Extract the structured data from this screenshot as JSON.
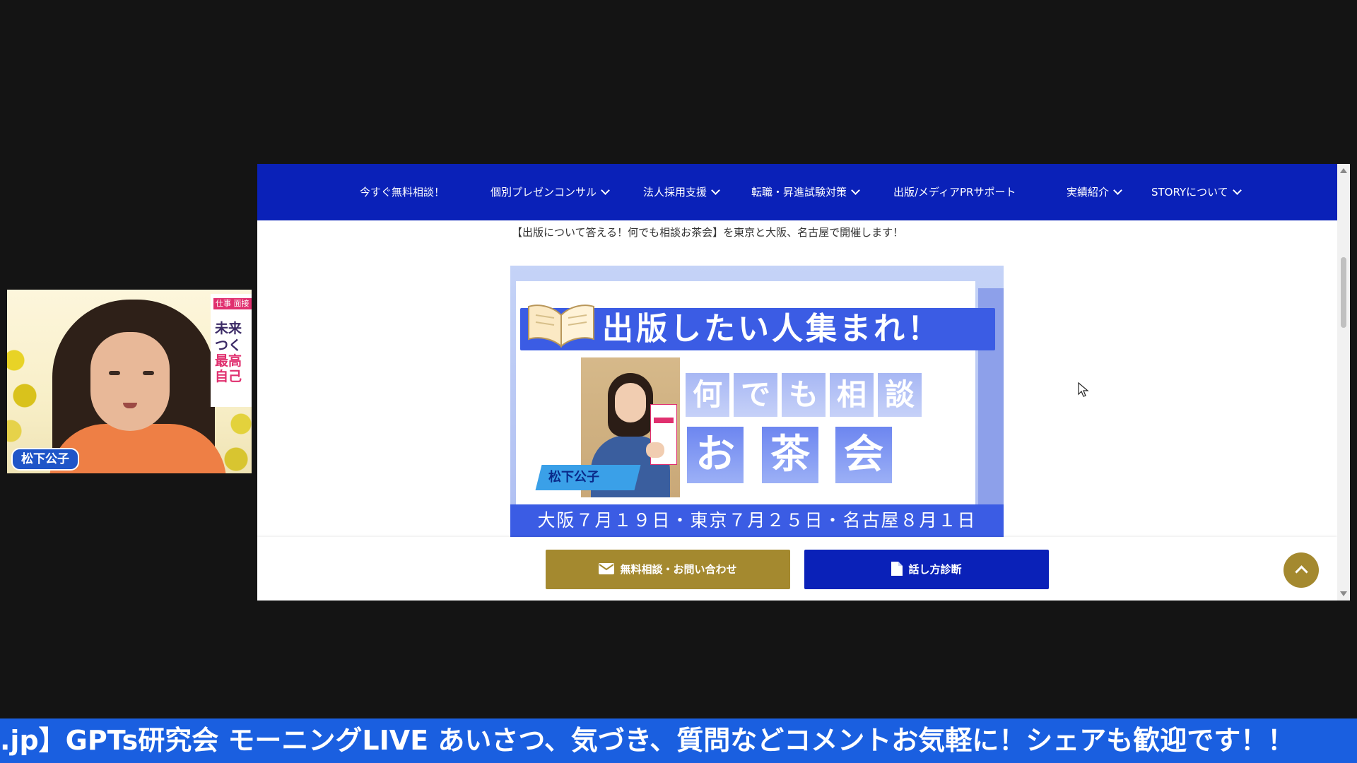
{
  "webcam": {
    "name_badge": "松下公子",
    "book_tag": "仕事 面接",
    "book_lines": [
      "未来",
      "つく",
      "最高",
      "自己"
    ]
  },
  "nav": {
    "items": [
      {
        "label": "今すぐ無料相談！",
        "dropdown": false
      },
      {
        "label": "個別プレゼンコンサル",
        "dropdown": true
      },
      {
        "label": "法人採用支援",
        "dropdown": true
      },
      {
        "label": "転職・昇進試験対策",
        "dropdown": true
      },
      {
        "label": "出版/メディアPRサポート",
        "dropdown": false
      },
      {
        "label": "実績紹介",
        "dropdown": true
      },
      {
        "label": "STORYについて",
        "dropdown": true
      }
    ]
  },
  "content": {
    "intro_text": "【出版について答える！何でも相談お茶会】を東京と大阪、名古屋で開催します！"
  },
  "banner": {
    "headline": "出版したい人集まれ！",
    "name_label": "松下公子",
    "tiles_top": [
      "何",
      "で",
      "も",
      "相",
      "談"
    ],
    "tiles_bottom": [
      "お",
      "茶",
      "会"
    ],
    "dates": "大阪７月１９日・東京７月２５日・名古屋８月１日"
  },
  "buttons": {
    "contact_label": "無料相談・お問い合わせ",
    "diagnosis_label": "話し方診断"
  },
  "colors": {
    "nav_bg": "#0a21b8",
    "gold": "#a4892f",
    "banner_blue": "#3b5ce4",
    "ticker_bg": "#1a5fe0"
  },
  "ticker": {
    "text": ".jp】GPTs研究会 モーニングLIVE あいさつ、気づき、質問などコメントお気軽に！シェアも歓迎です！！"
  },
  "icons": {
    "contact": "envelope-icon",
    "diagnosis": "document-icon",
    "back_to_top": "chevron-up-icon",
    "cursor": "mouse-cursor-icon"
  }
}
